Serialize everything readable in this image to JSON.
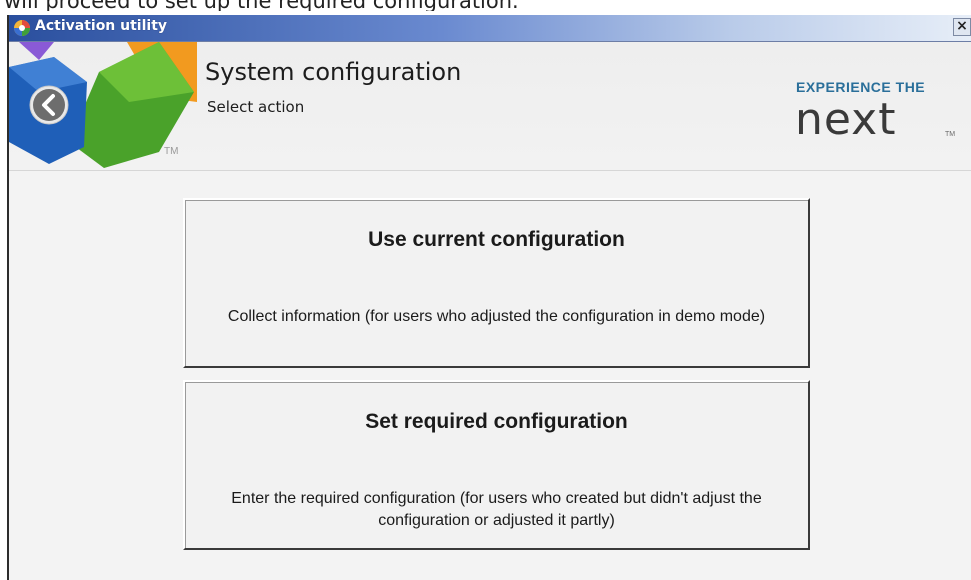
{
  "caption": "will proceed to set up the required configuration.",
  "window": {
    "title": "Activation utility",
    "close_label": "×"
  },
  "header": {
    "title": "System configuration",
    "subtitle": "Select action",
    "logo_tm": "TM",
    "brand_tagline": "EXPERIENCE THE",
    "brand_name": "next",
    "brand_tm": "TM"
  },
  "actions": [
    {
      "title": "Use current configuration",
      "description": "Collect information (for users who adjusted the configuration in demo mode)"
    },
    {
      "title": "Set required configuration",
      "description": "Enter the required configuration (for users who created but didn't adjust the configuration or adjusted it partly)"
    }
  ],
  "colors": {
    "titlebar_start": "#2a4f9e",
    "brand_blue": "#2a6f9a",
    "logo_green": "#4aa22a",
    "logo_blue": "#1f5fb8",
    "logo_orange": "#f29a1f",
    "logo_purple": "#8a5ad6"
  }
}
